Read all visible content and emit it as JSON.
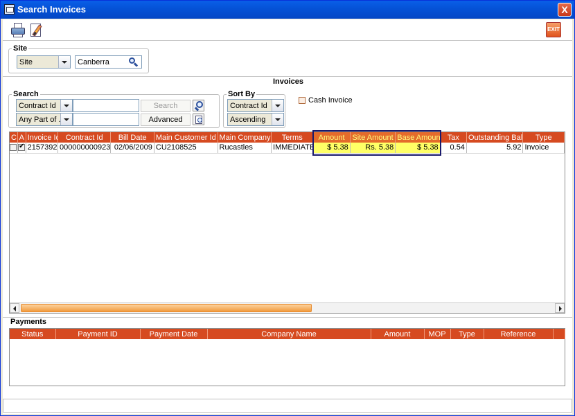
{
  "window": {
    "title": "Search Invoices",
    "close_label": "X",
    "exit_label": "EXIT"
  },
  "site": {
    "legend": "Site",
    "selector_value": "Site",
    "site_value": "Canberra"
  },
  "invoices": {
    "section_title": "Invoices",
    "search": {
      "legend": "Search",
      "field_value": "Contract Id",
      "match_value": "Any Part of ...",
      "search_button": "Search",
      "advanced_button": "Advanced"
    },
    "sort": {
      "legend": "Sort By",
      "field_value": "Contract Id",
      "order_value": "Ascending"
    },
    "cash_invoice_label": "Cash Invoice",
    "columns": [
      "C",
      "A",
      "Invoice Id",
      "Contract Id",
      "Bill Date",
      "Main Customer Id",
      "Main Company",
      "Terms",
      "Amount",
      "Site Amount",
      "Base Amount",
      "Tax",
      "Outstanding Bal.",
      "Type"
    ],
    "rows": [
      {
        "c": false,
        "a": true,
        "invoice_id": "2157392",
        "contract_id": "000000000923",
        "bill_date": "02/06/2009",
        "main_customer_id": "CU2108525",
        "main_company": "Rucastles",
        "terms": "IMMEDIATE",
        "amount": "$ 5.38",
        "site_amount": "Rs. 5.38",
        "base_amount": "$ 5.38",
        "tax": "0.54",
        "outstanding_bal": "5.92",
        "type": "Invoice"
      }
    ]
  },
  "payments": {
    "section_title": "Payments",
    "columns": [
      "Status",
      "Payment ID",
      "Payment Date",
      "Company Name",
      "Amount",
      "MOP",
      "Type",
      "Reference"
    ]
  },
  "colors": {
    "header": "#d64a20",
    "highlight_cell": "#ffff66",
    "title_bar": "#0553d8"
  }
}
